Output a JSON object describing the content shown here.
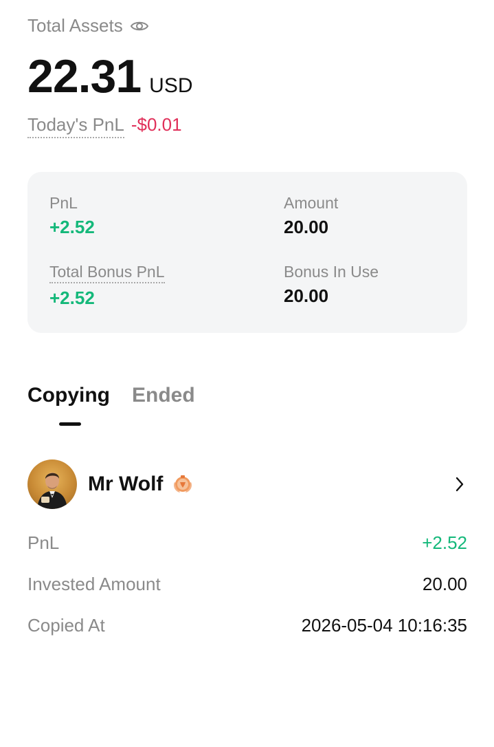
{
  "header": {
    "total_assets_label": "Total Assets",
    "total_assets_value": "22.31",
    "currency": "USD",
    "todays_pnl_label": "Today's PnL",
    "todays_pnl_value": "-$0.01"
  },
  "summary": {
    "pnl_label": "PnL",
    "pnl_value": "+2.52",
    "amount_label": "Amount",
    "amount_value": "20.00",
    "total_bonus_pnl_label": "Total Bonus PnL",
    "total_bonus_pnl_value": "+2.52",
    "bonus_in_use_label": "Bonus In Use",
    "bonus_in_use_value": "20.00"
  },
  "tabs": [
    {
      "label": "Copying",
      "active": true
    },
    {
      "label": "Ended",
      "active": false
    }
  ],
  "trader": {
    "name": "Mr Wolf",
    "badge_icon": "bronze-medal-icon",
    "details": {
      "pnl_label": "PnL",
      "pnl_value": "+2.52",
      "invested_label": "Invested Amount",
      "invested_value": "20.00",
      "copied_at_label": "Copied At",
      "copied_at_value": "2026-05-04 10:16:35"
    }
  },
  "colors": {
    "positive": "#14b87a",
    "negative": "#e0305a",
    "muted": "#8a8a8a",
    "card_bg": "#f4f5f6"
  }
}
